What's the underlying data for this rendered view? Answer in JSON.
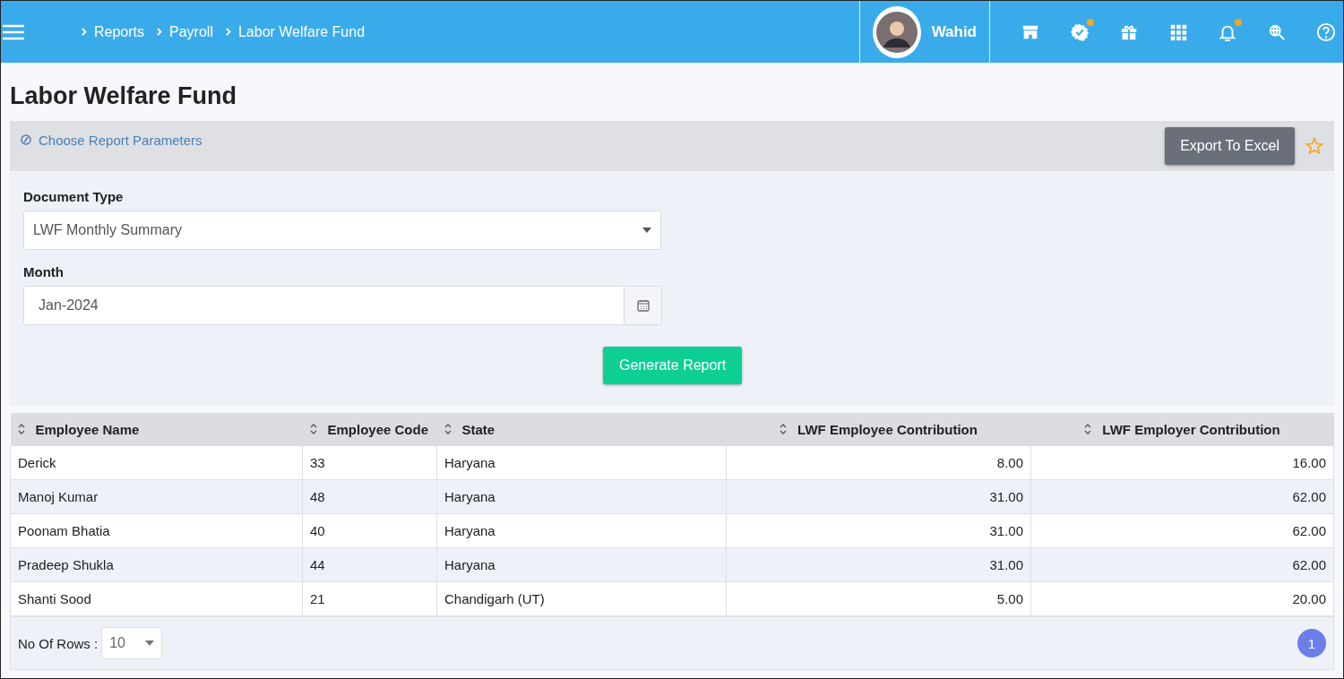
{
  "breadcrumb": [
    {
      "label": "Reports"
    },
    {
      "label": "Payroll"
    },
    {
      "label": "Labor Welfare Fund"
    }
  ],
  "user": {
    "name": "Wahid"
  },
  "toolbar_icons": [
    {
      "badge": false
    },
    {
      "badge": true
    },
    {
      "badge": false
    },
    {
      "badge": false
    },
    {
      "badge": true
    },
    {
      "badge": false
    },
    {
      "badge": false
    }
  ],
  "page_title": "Labor Welfare Fund",
  "parameters": {
    "heading": "Choose Report Parameters",
    "export_button": "Export To Excel",
    "favorite": false,
    "fields": [
      {
        "kind": "select",
        "label": "Document Type",
        "value": "LWF Monthly Summary"
      },
      {
        "kind": "date",
        "label": "Month",
        "value": "Jan-2024"
      }
    ],
    "generate_button": "Generate Report"
  },
  "table": {
    "columns": [
      {
        "label": "Employee Name"
      },
      {
        "label": "Employee Code"
      },
      {
        "label": "State"
      },
      {
        "label": "LWF Employee Contribution"
      },
      {
        "label": "LWF Employer Contribution"
      }
    ],
    "rows": [
      [
        "Derick",
        "33",
        "Haryana",
        "8.00",
        "16.00"
      ],
      [
        "Manoj Kumar",
        "48",
        "Haryana",
        "31.00",
        "62.00"
      ],
      [
        "Poonam Bhatia",
        "40",
        "Haryana",
        "31.00",
        "62.00"
      ],
      [
        "Pradeep Shukla",
        "44",
        "Haryana",
        "31.00",
        "62.00"
      ],
      [
        "Shanti Sood",
        "21",
        "Chandigarh (UT)",
        "5.00",
        "20.00"
      ]
    ]
  },
  "footer": {
    "rows_label": "No Of Rows :",
    "rows_value": "10",
    "pages": [
      {
        "label": "1",
        "selected": true
      }
    ]
  }
}
